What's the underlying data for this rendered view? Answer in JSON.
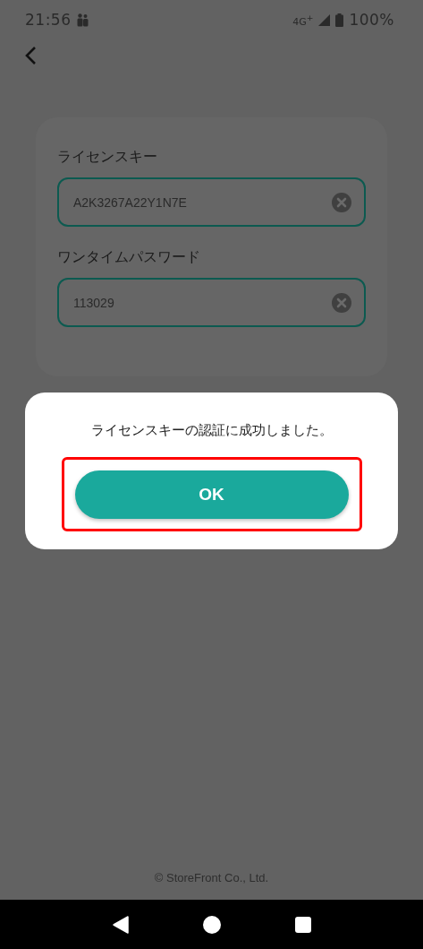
{
  "status_bar": {
    "time": "21:56",
    "network": "4G$^{+}$",
    "battery": "100%"
  },
  "form": {
    "fields": [
      {
        "label": "ライセンスキー",
        "value": "A2K3267A22Y1N7E"
      },
      {
        "label": "ワンタイムパスワード",
        "value": "113029"
      }
    ]
  },
  "dialog": {
    "message": "ライセンスキーの認証に成功しました。",
    "button": {
      "label": "OK",
      "highlighted": true
    }
  },
  "footer": "© StoreFront Co., Ltd."
}
